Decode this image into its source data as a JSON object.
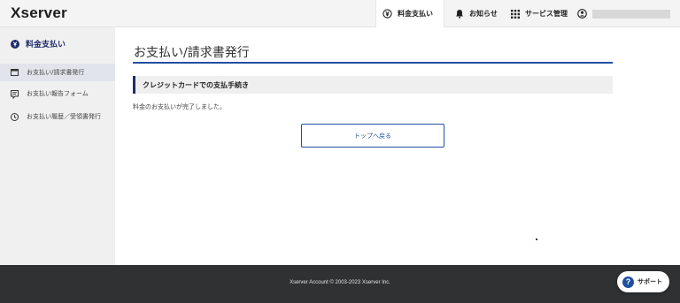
{
  "header": {
    "logo": "Xserver",
    "nav": {
      "fee": "料金支払い",
      "notice": "お知らせ",
      "service": "サービス管理"
    }
  },
  "sidebar": {
    "heading": "料金支払い",
    "items": [
      {
        "label": "お支払い/請求書発行",
        "icon": "receipt-icon",
        "active": true
      },
      {
        "label": "お支払い報告フォーム",
        "icon": "form-icon",
        "active": false
      },
      {
        "label": "お支払い履歴／受領書発行",
        "icon": "history-icon",
        "active": false
      }
    ]
  },
  "main": {
    "title": "お支払い/請求書発行",
    "section_title": "クレジットカードでの支払手続き",
    "message": "料金のお支払いが完了しました。",
    "back_button": "トップへ戻る"
  },
  "footer": {
    "copyright": "Xserver Account © 2003-2023 Xserver Inc.",
    "support": "サポート",
    "support_icon_glyph": "?"
  },
  "colors": {
    "accent": "#1f4fa0",
    "navy": "#1f2d6b",
    "footer_bg": "#2f3133"
  }
}
